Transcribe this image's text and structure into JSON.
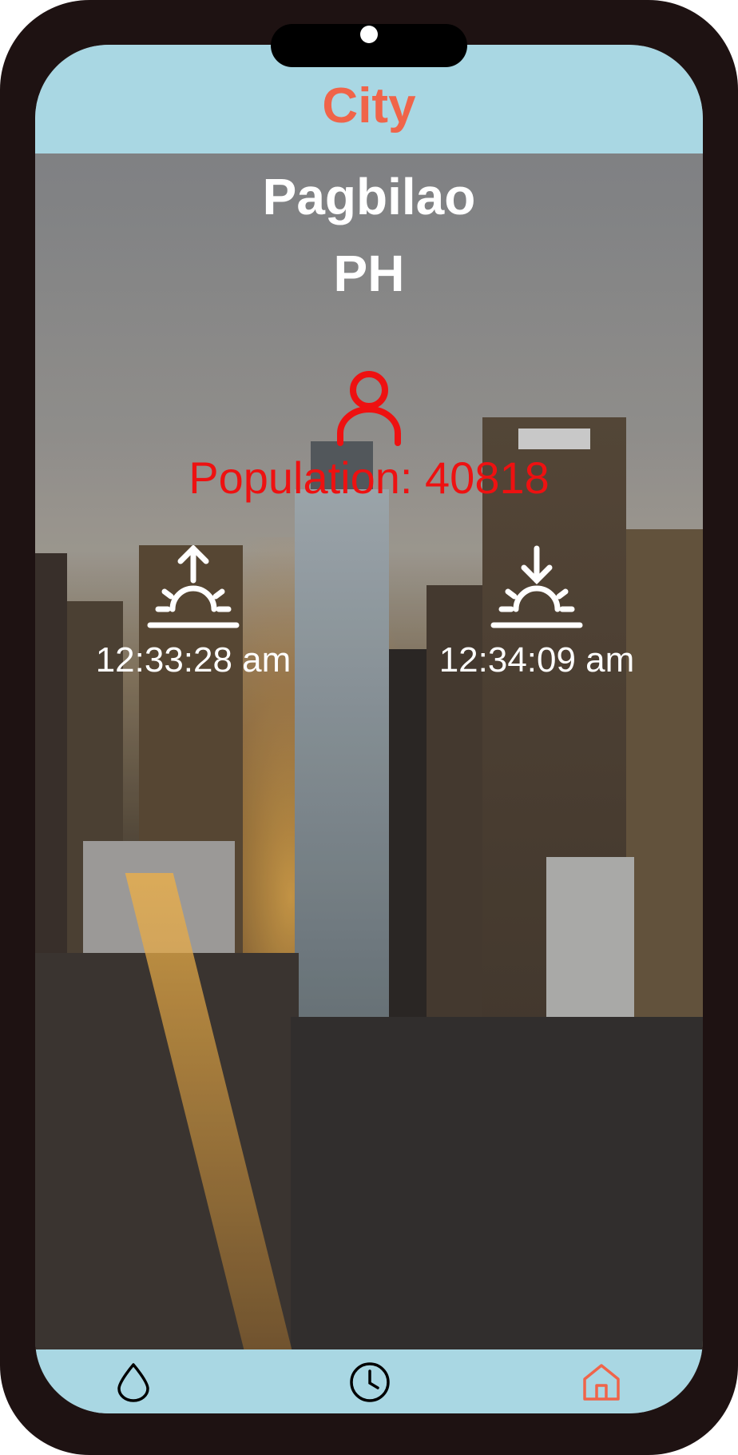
{
  "app_bar": {
    "title": "City"
  },
  "city": {
    "name": "Pagbilao",
    "country": "PH",
    "population_label": "Population: 40818"
  },
  "sun": {
    "sunrise_time": "12:33:28 am",
    "sunset_time": "12:34:09 am"
  },
  "nav": {
    "items": [
      {
        "icon": "water-drop-icon",
        "active": false
      },
      {
        "icon": "clock-icon",
        "active": false
      },
      {
        "icon": "home-icon",
        "active": true
      }
    ]
  },
  "colors": {
    "bar_background": "#a9d7e3",
    "title_accent": "#f06449",
    "population_red": "#ee1111",
    "frame": "#1e1212"
  }
}
